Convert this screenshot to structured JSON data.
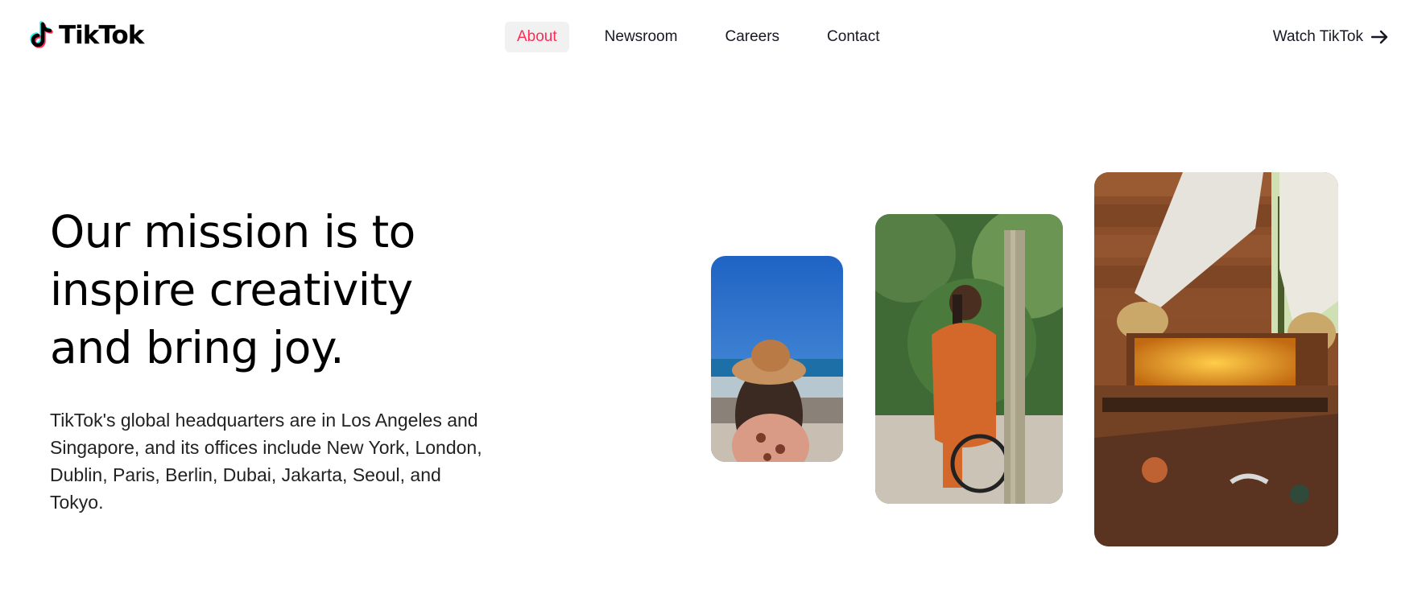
{
  "header": {
    "logo_text": "TikTok",
    "nav": [
      {
        "label": "About",
        "active": true
      },
      {
        "label": "Newsroom",
        "active": false
      },
      {
        "label": "Careers",
        "active": false
      },
      {
        "label": "Contact",
        "active": false
      }
    ],
    "cta_label": "Watch TikTok",
    "cta_icon": "arrow-right-icon"
  },
  "hero": {
    "headline_lines": [
      "Our mission is to",
      "inspire creativity",
      "and bring joy."
    ],
    "body": "TikTok's global headquarters are in Los Angeles and Singapore, and its offices include New York, London, Dublin, Paris, Berlin, Dubai, Jakarta, Seoul, and Tokyo."
  },
  "media": [
    {
      "subject": "woman in sun hat overlooking the sea"
    },
    {
      "subject": "smiling woman riding a bicycle in a park"
    },
    {
      "subject": "beekeeper lifting a honeycomb frame from a hive"
    }
  ],
  "colors": {
    "accent": "#fe2c55",
    "cyan": "#25f4ee",
    "nav_active_bg": "#f1f1f2",
    "text": "#161823"
  }
}
